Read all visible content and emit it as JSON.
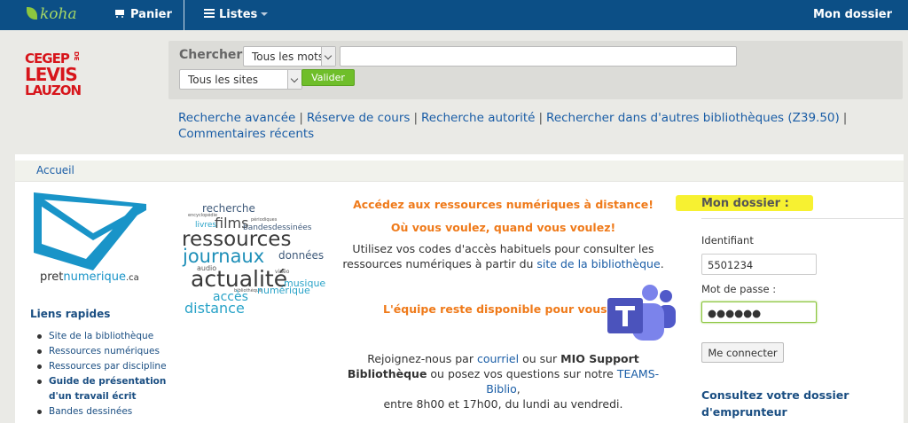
{
  "navbar": {
    "logo": "koha",
    "cart": "Panier",
    "lists": "Listes",
    "account": "Mon dossier"
  },
  "institution_logo": {
    "line1": "CEGEP",
    "de": "DE",
    "line2": "LEVIS",
    "line3": "LAUZON"
  },
  "search": {
    "label": "Chercher",
    "scope_select": "Tous les mots",
    "sites_select": "Tous les sites",
    "query_value": "",
    "submit": "Valider"
  },
  "links": [
    "Recherche avancée",
    "Réserve de cours",
    "Recherche autorité",
    "Rechercher dans d'autres bibliothèques (Z39.50)",
    "Commentaires récents"
  ],
  "breadcrumb": "Accueil",
  "pret_logo": {
    "part1": "pret",
    "part2": "numerique",
    "part3": ".ca"
  },
  "quick_links": {
    "title": "Liens rapides",
    "items": [
      "Site de la bibliothèque",
      "Ressources numériques",
      "Ressources par discipline",
      "Guide de présentation",
      "d'un travail écrit",
      "Bandes dessinées"
    ]
  },
  "word_cloud": {
    "recherche": "recherche",
    "films": "films",
    "encyclopedie": "encyclopédie",
    "periodiques": "périodiques",
    "livres": "livres",
    "bandesdessinees": "bandesdessinées",
    "ressources": "ressources",
    "journaux": "journaux",
    "donnees": "données",
    "audio": "audio",
    "actualite": "actualité",
    "video": "vidéo",
    "musique": "musique",
    "bibliotheque": "bibliothèque",
    "numerique": "numérique",
    "acces": "accès",
    "distance": "distance"
  },
  "center": {
    "headline1": "Accédez aux ressources numériques à distance!",
    "headline2": "Où vous voulez, quand vous voulez!",
    "intro_part1": "Utilisez vos codes d'accès habituels pour consulter les ressources numériques à partir du ",
    "intro_link": "site de la bibliothèque",
    "intro_end": ".",
    "team_msg": "L'équipe reste disponible pour vous",
    "contact_part1": "Rejoignez-nous par ",
    "contact_link1": "courriel",
    "contact_part2": " ou sur ",
    "contact_bold": "MIO Support Bibliothèque",
    "contact_part3": " ou posez vos questions sur notre ",
    "contact_link2": "TEAMS-Biblio",
    "contact_part4": ",",
    "contact_part5": "entre 8h00 et 17h00, du lundi au vendredi."
  },
  "login": {
    "title": "Mon dossier :",
    "id_label": "Identifiant",
    "id_value": "5501234",
    "pw_label": "Mot de passe :",
    "pw_value": "●●●●●●",
    "button": "Me connecter",
    "account_link": "Consultez votre dossier d'emprunteur"
  },
  "colors": {
    "navbar": "#0c4f86",
    "accent_orange": "#ef7a1a",
    "link_blue": "#1a5da6",
    "submit_green": "#6fbe2a",
    "highlight_yellow": "#f6f01b",
    "cegep_red": "#d7151b"
  }
}
